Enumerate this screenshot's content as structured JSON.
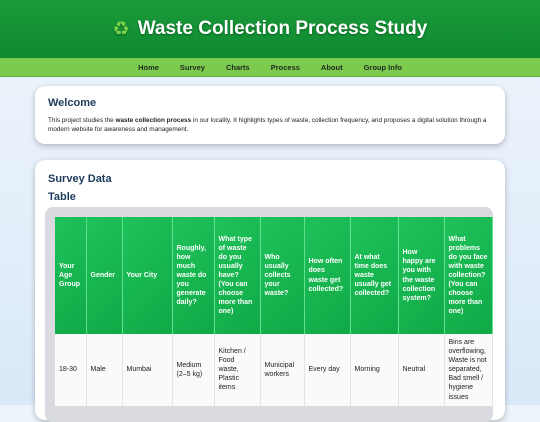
{
  "header": {
    "icon": "recycle-icon",
    "title": "Waste Collection Process Study"
  },
  "nav": [
    "Home",
    "Survey",
    "Charts",
    "Process",
    "About",
    "Group Info"
  ],
  "welcome": {
    "heading": "Welcome",
    "text_before": "This project studies the ",
    "text_bold": "waste collection process",
    "text_after": " in our locality. It highlights types of waste, collection frequency, and proposes a digital solution through a modern website for awareness and management."
  },
  "survey": {
    "heading": "Survey Data",
    "table_heading": "Table",
    "columns": [
      "Your Age Group",
      "Gender",
      "Your City",
      "Roughly, how much waste do you generate daily?",
      "What type of waste do you usually have? (You can choose more than one)",
      "Who usually collects your waste?",
      "How often does waste get collected?",
      "At what time does waste usually get collected?",
      "How happy are you with the waste collection system?",
      "What problems do you face with waste collection? (You can choose more than one)"
    ],
    "rows": [
      [
        "18-30",
        "Male",
        "Mumbai",
        "Medium (2–5 kg)",
        "Kitchen / Food waste, Plastic items",
        "Municipal workers",
        "Every day",
        "Morning",
        "Neutral",
        "Bins are overflowing, Waste is not separated, Bad smell / hygiene issues"
      ]
    ]
  }
}
